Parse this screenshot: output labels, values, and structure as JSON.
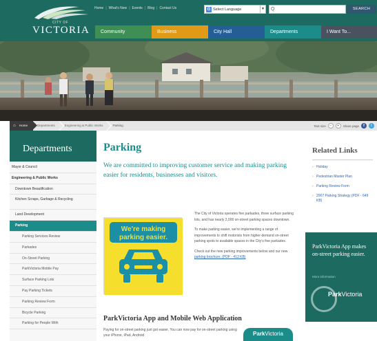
{
  "header": {
    "logo_small": "CITY OF",
    "logo_large": "VICTORIA",
    "utility_links": [
      "Home",
      "What's New",
      "Events",
      "Blog",
      "Contact Us"
    ],
    "language_label": "Select Language",
    "language_caret": "▼",
    "search_icon": "Q",
    "search_button": "SEARCH"
  },
  "nav": {
    "tabs": [
      "Community",
      "Business",
      "City Hall",
      "Departments",
      "I Want To..."
    ],
    "colors": [
      "#3f8f55",
      "#e09a18",
      "#245e94",
      "#1c8c8a",
      "#4a5260"
    ]
  },
  "breadcrumb": {
    "items": [
      "Home",
      "Departments",
      "Engineering & Public Works",
      "Parking"
    ],
    "text_size_label": "Text size",
    "share_label": "Share page"
  },
  "sidebar": {
    "title": "Departments",
    "items": [
      "Mayor & Council",
      "Engineering & Public Works",
      "Downtown Beautification",
      "Kitchen Scraps, Garbage & Recycling",
      "Land Development",
      "Parking",
      "Parking Services Review",
      "Parkades",
      "On-Street Parking",
      "ParkVictoria Mobile Pay",
      "Surface Parking Lots",
      "Pay Parking Tickets",
      "Parking Review Form",
      "Bicycle Parking",
      "Parking for People With"
    ]
  },
  "main": {
    "title": "Parking",
    "lead": "We are committed to improving customer service and making parking easier for residents, businesses and visitors.",
    "promo_line1": "We're making",
    "promo_line2": "parking easier.",
    "para1": "The City of Victoria operates five parkades, three surface parking lots, and has nearly 2,000 on-street parking spaces downtown.",
    "para2": "To make parking easier, we're implementing a range of improvements to shift motorists from higher-demand on-street parking spots to available spaces in the City's five parkades.",
    "para3_a": "Check out the new parking improvements below and our new ",
    "para3_link": "parking brochure. (PDF - 412 KB)",
    "app_title": "ParkVictoria App and Mobile Web Application",
    "app_text": "Paying for on-street parking just got easier. You can now pay for on-street parking using your iPhone, iPad, Android",
    "app_logo_bold": "Park",
    "app_logo_rest": "Victoria"
  },
  "related": {
    "title": "Related Links",
    "items": [
      "Holiday",
      "Pedestrian Master Plan",
      "Parking Review Form",
      "2007 Parking Strategy (PDF - 649 KB)"
    ]
  },
  "app_card": {
    "heading": "ParkVictoria App makes on-street parking easier.",
    "more": "More information",
    "brand_bold": "Park",
    "brand_rest": "Victoria"
  }
}
